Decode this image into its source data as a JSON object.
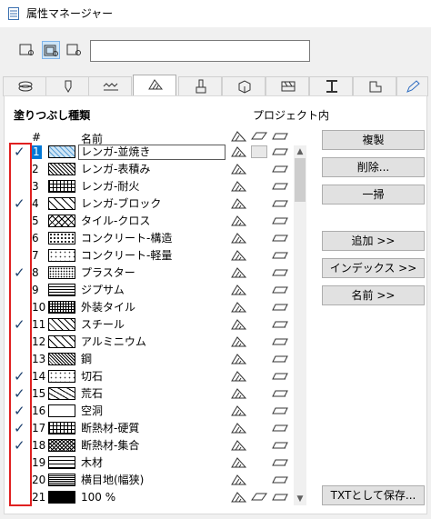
{
  "window": {
    "title": "属性マネージャー"
  },
  "toolbar": {
    "search_value": ""
  },
  "section": {
    "title": "塗りつぶし種類",
    "project_label": "プロジェクト内"
  },
  "columns": {
    "number": "#",
    "name": "名前"
  },
  "rows": [
    {
      "num": "1",
      "name": "レンガ-並焼き",
      "checked": "✓",
      "selected": true,
      "pattern": "diag-blue"
    },
    {
      "num": "2",
      "name": "レンガ-表積み",
      "checked": "",
      "pattern": "dense-diag"
    },
    {
      "num": "3",
      "name": "レンガ-耐火",
      "checked": "",
      "pattern": "grid"
    },
    {
      "num": "4",
      "name": "レンガ-ブロック",
      "checked": "✓",
      "pattern": "diag-wide"
    },
    {
      "num": "5",
      "name": "タイル-クロス",
      "checked": "",
      "pattern": "cross"
    },
    {
      "num": "6",
      "name": "コンクリート-構造",
      "checked": "",
      "pattern": "dots"
    },
    {
      "num": "7",
      "name": "コンクリート-軽量",
      "checked": "",
      "pattern": "dots-light"
    },
    {
      "num": "8",
      "name": "プラスター",
      "checked": "✓",
      "pattern": "dots-fine"
    },
    {
      "num": "9",
      "name": "ジプサム",
      "checked": "",
      "pattern": "hlines"
    },
    {
      "num": "10",
      "name": "外装タイル",
      "checked": "",
      "pattern": "grid-fine"
    },
    {
      "num": "11",
      "name": "スチール",
      "checked": "✓",
      "pattern": "diag-med"
    },
    {
      "num": "12",
      "name": "アルミニウム",
      "checked": "",
      "pattern": "diag-wide"
    },
    {
      "num": "13",
      "name": "鋼",
      "checked": "",
      "pattern": "diag-dense2"
    },
    {
      "num": "14",
      "name": "切石",
      "checked": "✓",
      "pattern": "dots-light"
    },
    {
      "num": "15",
      "name": "荒石",
      "checked": "✓",
      "pattern": "stone"
    },
    {
      "num": "16",
      "name": "空洞",
      "checked": "✓",
      "pattern": "empty"
    },
    {
      "num": "17",
      "name": "断熱材-硬質",
      "checked": "✓",
      "pattern": "grid"
    },
    {
      "num": "18",
      "name": "断熱材-集合",
      "checked": "✓",
      "pattern": "wave"
    },
    {
      "num": "19",
      "name": "木材",
      "checked": "",
      "pattern": "wood"
    },
    {
      "num": "20",
      "name": "横目地(幅狭)",
      "checked": "",
      "pattern": "hlines-dense"
    },
    {
      "num": "21",
      "name": "100 %",
      "checked": "",
      "pattern": "solid"
    }
  ],
  "buttons": {
    "duplicate": "複製",
    "delete": "削除...",
    "purge": "一掃",
    "add": "追加 >>",
    "index": "インデックス >>",
    "name": "名前 >>",
    "save_txt": "TXTとして保存..."
  },
  "icons": {
    "app": "app-icon",
    "filter1": "filter-list-icon",
    "filter2": "filter-used-icon",
    "filter3": "filter-search-icon"
  },
  "colors": {
    "accent": "#0078d7",
    "highlight_box": "#e02020",
    "selected_swatch": "#5aa0d8"
  }
}
